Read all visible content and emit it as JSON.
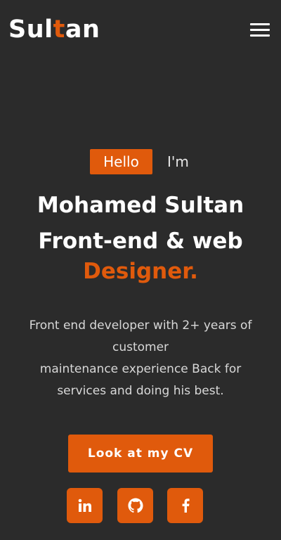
{
  "header": {
    "logo_part1": "Sul",
    "logo_accent": "t",
    "logo_part2": "an",
    "menu_icon": "hamburger-menu-icon"
  },
  "hero": {
    "hello_badge": "Hello",
    "intro": "I'm",
    "name": "Mohamed Sultan",
    "role_line1": "Front-end & web",
    "role_line2": "Designer.",
    "description_lines": [
      "Front end developer with 2+ years of",
      "customer",
      "maintenance experience Back for",
      "services and doing his best."
    ],
    "cv_button": "Look at my CV"
  },
  "social": [
    {
      "icon": "linkedin-icon"
    },
    {
      "icon": "github-icon"
    },
    {
      "icon": "facebook-icon"
    }
  ],
  "colors": {
    "background": "#2b2b2b",
    "accent": "#e05a0c",
    "text": "#ffffff"
  }
}
